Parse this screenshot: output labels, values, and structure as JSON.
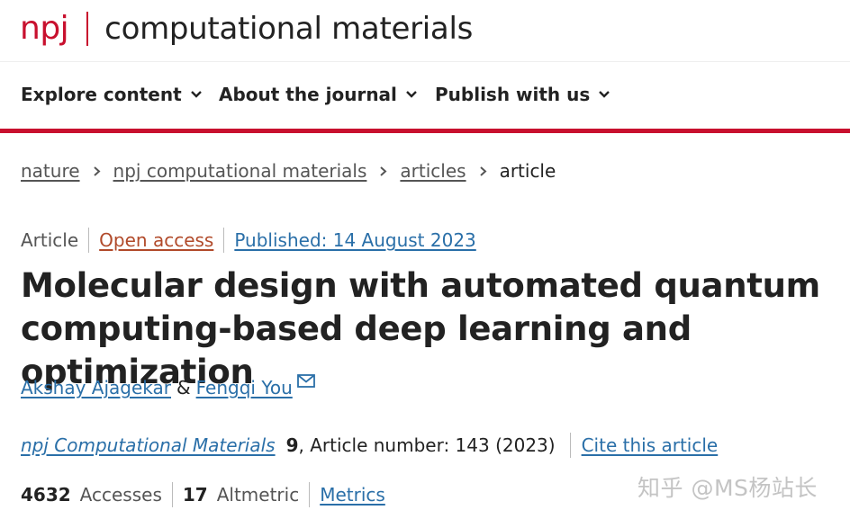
{
  "header": {
    "logo_prefix": "npj",
    "journal_name": "computational materials"
  },
  "nav": {
    "items": [
      {
        "label": "Explore content"
      },
      {
        "label": "About the journal"
      },
      {
        "label": "Publish with us"
      }
    ]
  },
  "breadcrumb": {
    "items": [
      "nature",
      "npj computational materials",
      "articles"
    ],
    "current": "article"
  },
  "article": {
    "type": "Article",
    "access": "Open access",
    "published": "Published: 14 August 2023",
    "title": "Molecular design with automated quantum computing-based deep learning and optimization",
    "authors": [
      "Akshay Ajagekar",
      "Fengqi You"
    ],
    "author_separator": "&",
    "journal": "npj Computational Materials",
    "volume": "9",
    "article_number": ", Article number: 143 (2023)",
    "cite_label": "Cite this article"
  },
  "metrics": {
    "accesses_count": "4632",
    "accesses_label": "Accesses",
    "altmetric_count": "17",
    "altmetric_label": "Altmetric",
    "metrics_link": "Metrics"
  },
  "watermark": "知乎 @MS杨站长",
  "colors": {
    "brand_red": "#c8102e",
    "link_blue": "#2a6fa8",
    "open_access": "#b14a2a"
  },
  "icons": {
    "nav_dropdown": "chevron-down-icon",
    "breadcrumb_separator": "chevron-right-icon",
    "corresponding_author": "envelope-icon"
  }
}
